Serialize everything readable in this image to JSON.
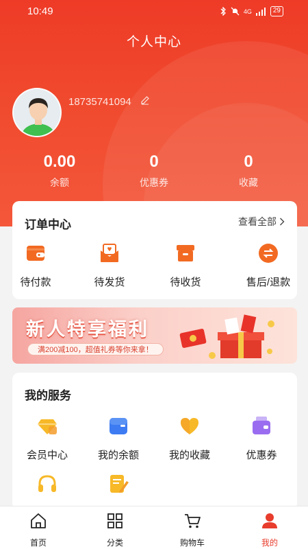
{
  "status_bar": {
    "time": "10:49",
    "signal_text": "4G",
    "battery": "29"
  },
  "title": "个人中心",
  "profile": {
    "phone": "18735741094"
  },
  "stats": [
    {
      "value": "0.00",
      "label": "余额"
    },
    {
      "value": "0",
      "label": "优惠券"
    },
    {
      "value": "0",
      "label": "收藏"
    }
  ],
  "orders": {
    "title": "订单中心",
    "view_all": "查看全部",
    "items": [
      {
        "label": "待付款",
        "icon": "wallet-icon"
      },
      {
        "label": "待发货",
        "icon": "envelope-heart-icon"
      },
      {
        "label": "待收货",
        "icon": "box-icon"
      },
      {
        "label": "售后/退款",
        "icon": "exchange-icon"
      }
    ]
  },
  "banner": {
    "title": "新人特享福利",
    "subtitle": "满200减100，超值礼券等你来拿！"
  },
  "services": {
    "title": "我的服务",
    "items": [
      {
        "label": "会员中心",
        "icon": "diamond-icon"
      },
      {
        "label": "我的余额",
        "icon": "wallet-card-icon"
      },
      {
        "label": "我的收藏",
        "icon": "heart-icon"
      },
      {
        "label": "优惠券",
        "icon": "coupon-icon"
      },
      {
        "label": "",
        "icon": "headset-icon"
      },
      {
        "label": "",
        "icon": "notepad-icon"
      }
    ]
  },
  "tabbar": {
    "items": [
      {
        "label": "首页",
        "icon": "home-icon"
      },
      {
        "label": "分类",
        "icon": "grid-icon"
      },
      {
        "label": "购物车",
        "icon": "cart-icon"
      },
      {
        "label": "我的",
        "icon": "user-icon",
        "active": true
      }
    ]
  },
  "colors": {
    "brand": "#ee3b27",
    "active_tab": "#e83c2c",
    "icon_orange": "#f26a22",
    "icon_yellow": "#f7b928",
    "icon_blue": "#3d7bf2",
    "icon_purple": "#9a6df0"
  }
}
